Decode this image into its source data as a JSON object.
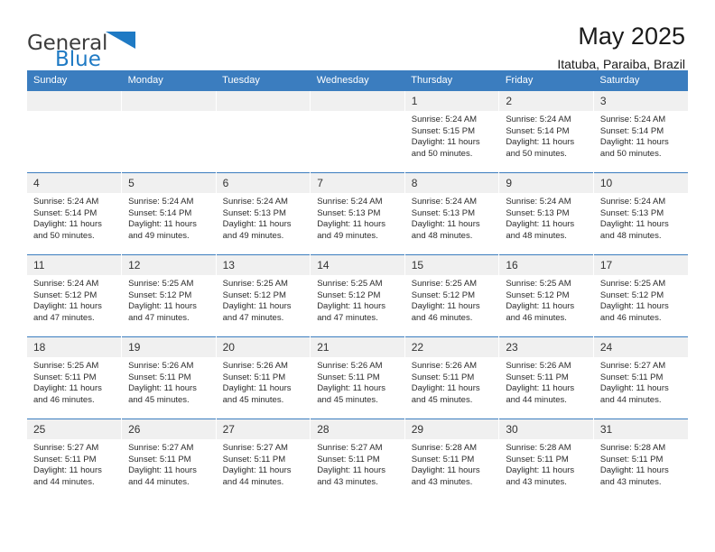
{
  "brand": {
    "name_top": "General",
    "name_bottom": "Blue",
    "flag_icon": "triangle-flag-icon",
    "accent_color": "#1f7ac4"
  },
  "header": {
    "title": "May 2025",
    "location": "Itatuba, Paraiba, Brazil"
  },
  "calendar": {
    "header_bg": "#3b7dbf",
    "daynum_bg": "#f0f0f0",
    "weekday_headers": [
      "Sunday",
      "Monday",
      "Tuesday",
      "Wednesday",
      "Thursday",
      "Friday",
      "Saturday"
    ],
    "weeks": [
      [
        {
          "day": "",
          "empty": true
        },
        {
          "day": "",
          "empty": true
        },
        {
          "day": "",
          "empty": true
        },
        {
          "day": "",
          "empty": true
        },
        {
          "day": "1",
          "sunrise": "Sunrise: 5:24 AM",
          "sunset": "Sunset: 5:15 PM",
          "daylight1": "Daylight: 11 hours",
          "daylight2": "and 50 minutes."
        },
        {
          "day": "2",
          "sunrise": "Sunrise: 5:24 AM",
          "sunset": "Sunset: 5:14 PM",
          "daylight1": "Daylight: 11 hours",
          "daylight2": "and 50 minutes."
        },
        {
          "day": "3",
          "sunrise": "Sunrise: 5:24 AM",
          "sunset": "Sunset: 5:14 PM",
          "daylight1": "Daylight: 11 hours",
          "daylight2": "and 50 minutes."
        }
      ],
      [
        {
          "day": "4",
          "sunrise": "Sunrise: 5:24 AM",
          "sunset": "Sunset: 5:14 PM",
          "daylight1": "Daylight: 11 hours",
          "daylight2": "and 50 minutes."
        },
        {
          "day": "5",
          "sunrise": "Sunrise: 5:24 AM",
          "sunset": "Sunset: 5:14 PM",
          "daylight1": "Daylight: 11 hours",
          "daylight2": "and 49 minutes."
        },
        {
          "day": "6",
          "sunrise": "Sunrise: 5:24 AM",
          "sunset": "Sunset: 5:13 PM",
          "daylight1": "Daylight: 11 hours",
          "daylight2": "and 49 minutes."
        },
        {
          "day": "7",
          "sunrise": "Sunrise: 5:24 AM",
          "sunset": "Sunset: 5:13 PM",
          "daylight1": "Daylight: 11 hours",
          "daylight2": "and 49 minutes."
        },
        {
          "day": "8",
          "sunrise": "Sunrise: 5:24 AM",
          "sunset": "Sunset: 5:13 PM",
          "daylight1": "Daylight: 11 hours",
          "daylight2": "and 48 minutes."
        },
        {
          "day": "9",
          "sunrise": "Sunrise: 5:24 AM",
          "sunset": "Sunset: 5:13 PM",
          "daylight1": "Daylight: 11 hours",
          "daylight2": "and 48 minutes."
        },
        {
          "day": "10",
          "sunrise": "Sunrise: 5:24 AM",
          "sunset": "Sunset: 5:13 PM",
          "daylight1": "Daylight: 11 hours",
          "daylight2": "and 48 minutes."
        }
      ],
      [
        {
          "day": "11",
          "sunrise": "Sunrise: 5:24 AM",
          "sunset": "Sunset: 5:12 PM",
          "daylight1": "Daylight: 11 hours",
          "daylight2": "and 47 minutes."
        },
        {
          "day": "12",
          "sunrise": "Sunrise: 5:25 AM",
          "sunset": "Sunset: 5:12 PM",
          "daylight1": "Daylight: 11 hours",
          "daylight2": "and 47 minutes."
        },
        {
          "day": "13",
          "sunrise": "Sunrise: 5:25 AM",
          "sunset": "Sunset: 5:12 PM",
          "daylight1": "Daylight: 11 hours",
          "daylight2": "and 47 minutes."
        },
        {
          "day": "14",
          "sunrise": "Sunrise: 5:25 AM",
          "sunset": "Sunset: 5:12 PM",
          "daylight1": "Daylight: 11 hours",
          "daylight2": "and 47 minutes."
        },
        {
          "day": "15",
          "sunrise": "Sunrise: 5:25 AM",
          "sunset": "Sunset: 5:12 PM",
          "daylight1": "Daylight: 11 hours",
          "daylight2": "and 46 minutes."
        },
        {
          "day": "16",
          "sunrise": "Sunrise: 5:25 AM",
          "sunset": "Sunset: 5:12 PM",
          "daylight1": "Daylight: 11 hours",
          "daylight2": "and 46 minutes."
        },
        {
          "day": "17",
          "sunrise": "Sunrise: 5:25 AM",
          "sunset": "Sunset: 5:12 PM",
          "daylight1": "Daylight: 11 hours",
          "daylight2": "and 46 minutes."
        }
      ],
      [
        {
          "day": "18",
          "sunrise": "Sunrise: 5:25 AM",
          "sunset": "Sunset: 5:11 PM",
          "daylight1": "Daylight: 11 hours",
          "daylight2": "and 46 minutes."
        },
        {
          "day": "19",
          "sunrise": "Sunrise: 5:26 AM",
          "sunset": "Sunset: 5:11 PM",
          "daylight1": "Daylight: 11 hours",
          "daylight2": "and 45 minutes."
        },
        {
          "day": "20",
          "sunrise": "Sunrise: 5:26 AM",
          "sunset": "Sunset: 5:11 PM",
          "daylight1": "Daylight: 11 hours",
          "daylight2": "and 45 minutes."
        },
        {
          "day": "21",
          "sunrise": "Sunrise: 5:26 AM",
          "sunset": "Sunset: 5:11 PM",
          "daylight1": "Daylight: 11 hours",
          "daylight2": "and 45 minutes."
        },
        {
          "day": "22",
          "sunrise": "Sunrise: 5:26 AM",
          "sunset": "Sunset: 5:11 PM",
          "daylight1": "Daylight: 11 hours",
          "daylight2": "and 45 minutes."
        },
        {
          "day": "23",
          "sunrise": "Sunrise: 5:26 AM",
          "sunset": "Sunset: 5:11 PM",
          "daylight1": "Daylight: 11 hours",
          "daylight2": "and 44 minutes."
        },
        {
          "day": "24",
          "sunrise": "Sunrise: 5:27 AM",
          "sunset": "Sunset: 5:11 PM",
          "daylight1": "Daylight: 11 hours",
          "daylight2": "and 44 minutes."
        }
      ],
      [
        {
          "day": "25",
          "sunrise": "Sunrise: 5:27 AM",
          "sunset": "Sunset: 5:11 PM",
          "daylight1": "Daylight: 11 hours",
          "daylight2": "and 44 minutes."
        },
        {
          "day": "26",
          "sunrise": "Sunrise: 5:27 AM",
          "sunset": "Sunset: 5:11 PM",
          "daylight1": "Daylight: 11 hours",
          "daylight2": "and 44 minutes."
        },
        {
          "day": "27",
          "sunrise": "Sunrise: 5:27 AM",
          "sunset": "Sunset: 5:11 PM",
          "daylight1": "Daylight: 11 hours",
          "daylight2": "and 44 minutes."
        },
        {
          "day": "28",
          "sunrise": "Sunrise: 5:27 AM",
          "sunset": "Sunset: 5:11 PM",
          "daylight1": "Daylight: 11 hours",
          "daylight2": "and 43 minutes."
        },
        {
          "day": "29",
          "sunrise": "Sunrise: 5:28 AM",
          "sunset": "Sunset: 5:11 PM",
          "daylight1": "Daylight: 11 hours",
          "daylight2": "and 43 minutes."
        },
        {
          "day": "30",
          "sunrise": "Sunrise: 5:28 AM",
          "sunset": "Sunset: 5:11 PM",
          "daylight1": "Daylight: 11 hours",
          "daylight2": "and 43 minutes."
        },
        {
          "day": "31",
          "sunrise": "Sunrise: 5:28 AM",
          "sunset": "Sunset: 5:11 PM",
          "daylight1": "Daylight: 11 hours",
          "daylight2": "and 43 minutes."
        }
      ]
    ]
  }
}
